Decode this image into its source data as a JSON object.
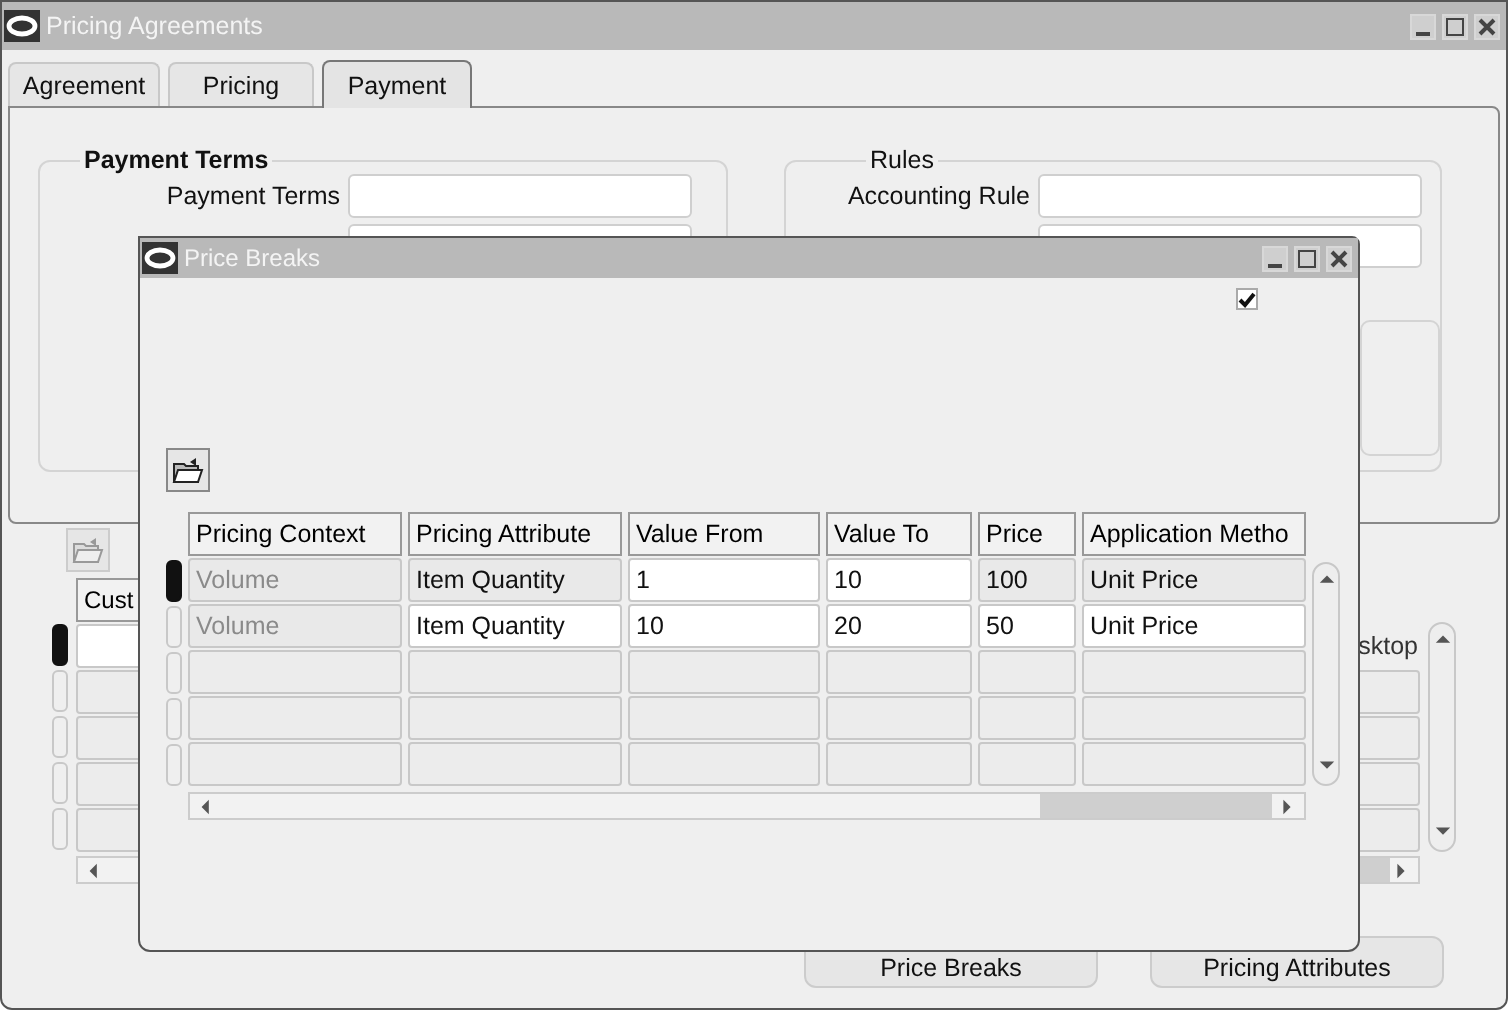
{
  "window": {
    "title": "Pricing Agreements"
  },
  "tabs": [
    {
      "label": "Agreement",
      "selected": false
    },
    {
      "label": "Pricing",
      "selected": false
    },
    {
      "label": "Payment",
      "selected": true
    }
  ],
  "payment_terms": {
    "title": "Payment Terms",
    "fields": [
      {
        "label": "Payment Terms"
      }
    ]
  },
  "rules": {
    "title": "Rules",
    "fields": [
      {
        "label": "Accounting Rule"
      }
    ]
  },
  "lines_table": {
    "columns": [
      "Cust"
    ],
    "side_column": "sktop",
    "rows": [
      {
        "selected": true
      },
      {
        "selected": false
      },
      {
        "selected": false
      },
      {
        "selected": false
      },
      {
        "selected": false
      }
    ]
  },
  "buttons": [
    "Price Breaks",
    "Pricing Attributes"
  ],
  "price_breaks": {
    "title": "Price Breaks",
    "checkbox": {
      "checked": true
    },
    "columns": [
      "Pricing Context",
      "Pricing Attribute",
      "Value From",
      "Value To",
      "Price",
      "Application Metho"
    ],
    "rows": [
      {
        "selected": true,
        "cells": [
          {
            "text": "Volume",
            "disabled": true,
            "editable": false
          },
          {
            "text": "Item Quantity",
            "disabled": false,
            "editable": false
          },
          {
            "text": "1",
            "disabled": false,
            "editable": true
          },
          {
            "text": "10",
            "disabled": false,
            "editable": true
          },
          {
            "text": "100",
            "disabled": false,
            "editable": false
          },
          {
            "text": "Unit Price",
            "disabled": false,
            "editable": false
          }
        ]
      },
      {
        "selected": false,
        "cells": [
          {
            "text": "Volume",
            "disabled": true,
            "editable": false
          },
          {
            "text": "Item Quantity",
            "disabled": false,
            "editable": true
          },
          {
            "text": "10",
            "disabled": false,
            "editable": true
          },
          {
            "text": "20",
            "disabled": false,
            "editable": true
          },
          {
            "text": "50",
            "disabled": false,
            "editable": true
          },
          {
            "text": "Unit Price",
            "disabled": false,
            "editable": true
          }
        ]
      },
      {
        "selected": false
      },
      {
        "selected": false
      },
      {
        "selected": false
      }
    ]
  }
}
